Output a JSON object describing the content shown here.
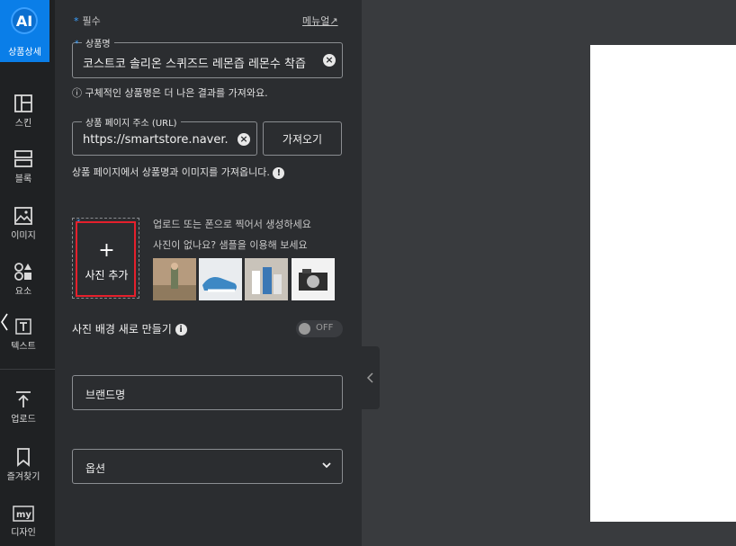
{
  "rail": {
    "ai_badge": "AI",
    "ai_label": "상품상세",
    "items": [
      {
        "label": "스킨",
        "icon": "layout-icon"
      },
      {
        "label": "블록",
        "icon": "blocks-icon"
      },
      {
        "label": "이미지",
        "icon": "image-icon"
      },
      {
        "label": "요소",
        "icon": "shapes-icon"
      },
      {
        "label": "텍스트",
        "icon": "text-icon"
      },
      {
        "label": "업로드",
        "icon": "upload-icon"
      },
      {
        "label": "즐겨찾기",
        "icon": "bookmark-icon"
      },
      {
        "label": "디자인",
        "icon": "my-design-icon"
      }
    ]
  },
  "panel": {
    "required_label": "필수",
    "manual_link": "메뉴얼↗",
    "product_name": {
      "legend": "상품명",
      "value": "코스트코 솔리온 스퀴즈드 레몬즙 레몬수 착즙"
    },
    "product_name_hint": "구체적인 상품명은 더 나은 결과를 가져와요.",
    "product_url": {
      "legend": "상품 페이지 주소 (URL)",
      "value": "https://smartstore.naver.com"
    },
    "fetch_button": "가져오기",
    "url_hint": "상품 페이지에서 상품명과 이미지를 가져옵니다.",
    "add_photo_label": "사진 추가",
    "upload_hint_1": "업로드 또는 폰으로 찍어서 생성하세요",
    "upload_hint_2": "사진이 없나요? 샘플을 이용해 보세요",
    "background_toggle_label": "사진 배경 새로 만들기",
    "toggle_state": "OFF",
    "brand_placeholder": "브랜드명",
    "option_label": "옵션"
  },
  "colors": {
    "accent": "#0a7ee8",
    "highlight": "#e5202c",
    "rail_bg": "#1f2123",
    "panel_bg": "#2b2d30",
    "workspace_bg": "#393b3e"
  }
}
